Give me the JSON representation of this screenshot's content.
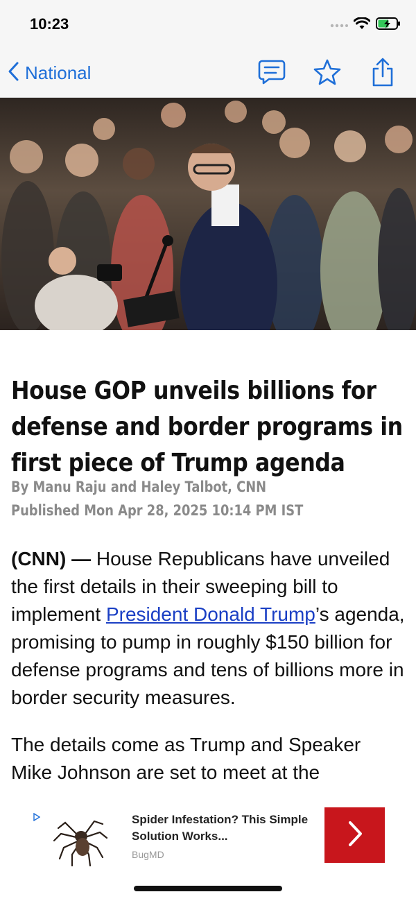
{
  "status_bar": {
    "time": "10:23"
  },
  "nav": {
    "back_label": "National",
    "actions": [
      "comment-icon",
      "star-icon",
      "share-icon"
    ]
  },
  "article": {
    "headline": "House GOP unveils billions for defense and border programs in first piece of Trump agenda",
    "byline": "By Manu Raju and Haley Talbot, CNN",
    "published": "Published Mon Apr 28, 2025 10:14 PM IST",
    "p1_lead": "(CNN) —",
    "p1_a": " House Republicans have unveiled the first details in their sweeping bill to implement ",
    "p1_link": "President Donald Trump",
    "p1_b": "’s agenda, promising to pump in roughly $150 billion for defense programs and tens of billions more in border security measures.",
    "p2": "The details come as Trump and Speaker Mike Johnson are set to meet at the"
  },
  "ad": {
    "title": "Spider Infestation? This Simple Solution Works...",
    "source": "BugMD",
    "choice_icon": "adchoices-icon",
    "cta_icon": "chevron-right-icon"
  },
  "colors": {
    "accent": "#1f6fd8",
    "link": "#1a3fc4",
    "ad_cta": "#c8161c",
    "meta_gray": "#8a8a8a"
  }
}
